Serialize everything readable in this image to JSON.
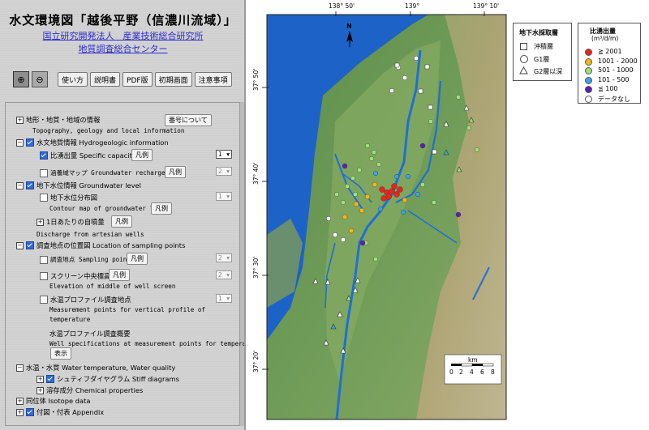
{
  "header": {
    "title": "水文環境図「越後平野（信濃川流域）」",
    "org_line1": "国立研究開発法人　産業技術総合研究所",
    "org_line2": "地質調査総合センター"
  },
  "toolbar": {
    "zoom_in": "⊕",
    "zoom_out": "⊖",
    "buttons": [
      "使い方",
      "説明書",
      "PDF版",
      "初期画面",
      "注意事項"
    ]
  },
  "layers": {
    "geo_label": "地形・地質・地域の情報",
    "geo_button": "番号について",
    "geo_en": "Topography, geology and local information",
    "hydro_label": "水文地質情報 Hydrogeologic information",
    "spec_label": "比湧出量 Specific capacity",
    "spec_legend": "凡例",
    "spec_select": "1",
    "recharge_label": "涵養域マップ Groundwater recharge map",
    "recharge_legend": "凡例",
    "recharge_select": "2",
    "gwl_label": "地下水位情報 Groundwater level",
    "contour_label": "地下水位分布図",
    "contour_en": "Contour map of groundwater level",
    "contour_legend": "凡例",
    "contour_select": "1",
    "discharge_label": "1日あたりの自噴量",
    "discharge_legend": "凡例",
    "discharge_en": "Discharge from artesian wells",
    "sampling_label": "調査地点の位置図 Location of sampling points",
    "sp_label": "調査地点 Sampling points",
    "sp_legend": "凡例",
    "sp_select": "2",
    "screen_label": "スクリーン中央標高",
    "screen_legend": "凡例",
    "screen_select": "2",
    "screen_en": "Elevation of middle of well screen",
    "temp_label": "水温プロファイル調査地点",
    "temp_select": "1",
    "temp_en1": "Measurement points for vertical profile of",
    "temp_en2": "temperature",
    "temp_summary_label": "水温プロファイル調査概要",
    "temp_summary_en": "Well specifications at measurement points for temperature profile",
    "temp_show": "表示",
    "wq_label": "水温・水質 Water temperature, Water quality",
    "stiff_label": "シュティフダイヤグラム Stiff diagrams",
    "chem_label": "溶存成分 Chemical properties",
    "isotope_label": "同位体 Isotope data",
    "appendix_label": "付図・付表 Appendix"
  },
  "map": {
    "lon_ticks": [
      "138° 50'",
      "139°",
      "139° 10'"
    ],
    "lat_ticks": [
      "37° 50'",
      "37° 40'",
      "37° 30'",
      "37° 20'"
    ],
    "north": "N",
    "scale_unit": "km",
    "scale_ticks": [
      "0",
      "2",
      "4",
      "6",
      "8"
    ],
    "legend_layer_title": "地下水採取層",
    "legend_layer_items": [
      "沖積層",
      "G1層",
      "G2層以深"
    ],
    "legend_cap_title": "比湧出量",
    "legend_cap_unit": "(m³/d/m)",
    "legend_cap_items": [
      {
        "label": "≧ 2001",
        "color": "#e8261d"
      },
      {
        "label": "1001 - 2000",
        "color": "#f2b51c"
      },
      {
        "label": "501 - 1000",
        "color": "#9ee07a"
      },
      {
        "label": "101 - 500",
        "color": "#3aa3e6"
      },
      {
        "label": "≦ 100",
        "color": "#5b1fb0"
      },
      {
        "label": "データなし",
        "color": "#ffffff"
      }
    ]
  }
}
